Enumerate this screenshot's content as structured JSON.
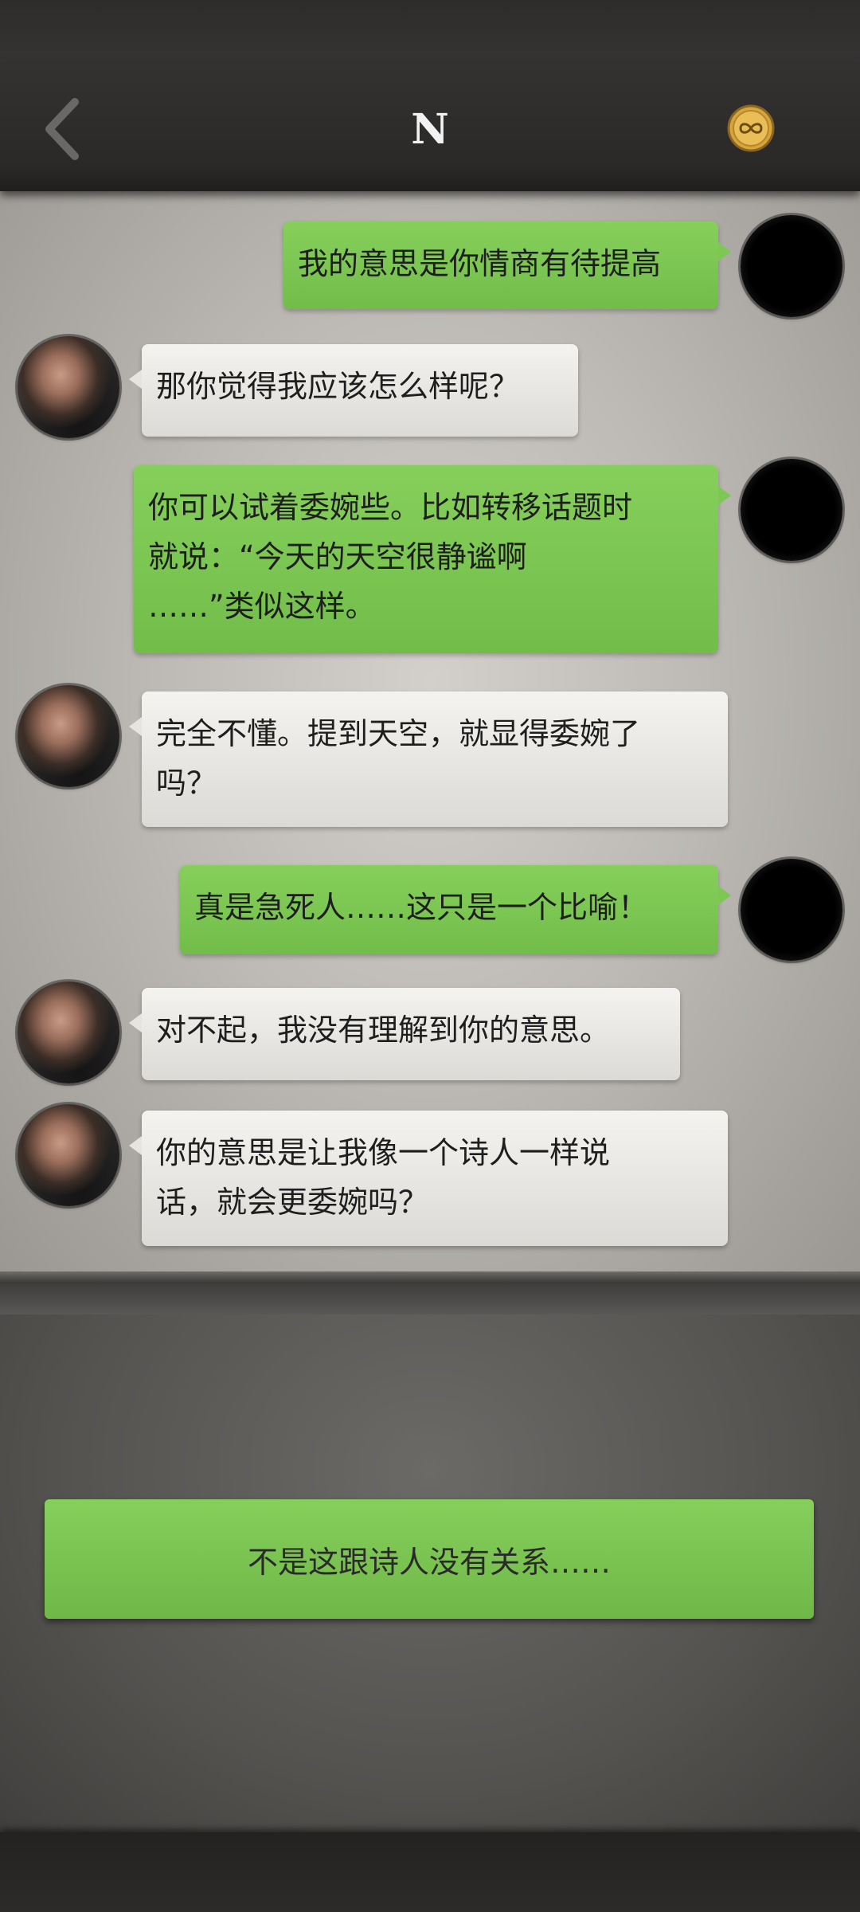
{
  "header": {
    "title": "N",
    "back_icon": "chevron-left-icon",
    "coin_icon": "infinity-coin-icon"
  },
  "messages": [
    {
      "from": "me",
      "text": "我的意思是你情商有待提高"
    },
    {
      "from": "npc",
      "text": "那你觉得我应该怎么样呢？"
    },
    {
      "from": "me",
      "lines": [
        "你可以试着委婉些。比如转移话题时",
        "就说：“今天的天空很静谧啊",
        "……”类似这样。"
      ]
    },
    {
      "from": "npc",
      "lines": [
        "完全不懂。提到天空，就显得委婉了",
        "吗？"
      ]
    },
    {
      "from": "me",
      "text": "真是急死人……这只是一个比喻！"
    },
    {
      "from": "npc",
      "text": "对不起，我没有理解到你的意思。"
    },
    {
      "from": "npc",
      "lines": [
        "你的意思是让我像一个诗人一样说",
        "话，就会更委婉吗？"
      ]
    }
  ],
  "choice": {
    "label": "不是这跟诗人没有关系……"
  },
  "colors": {
    "sent_bubble": "#7ec754",
    "recv_bubble": "#eceae6",
    "header": "#2d2c2b"
  }
}
